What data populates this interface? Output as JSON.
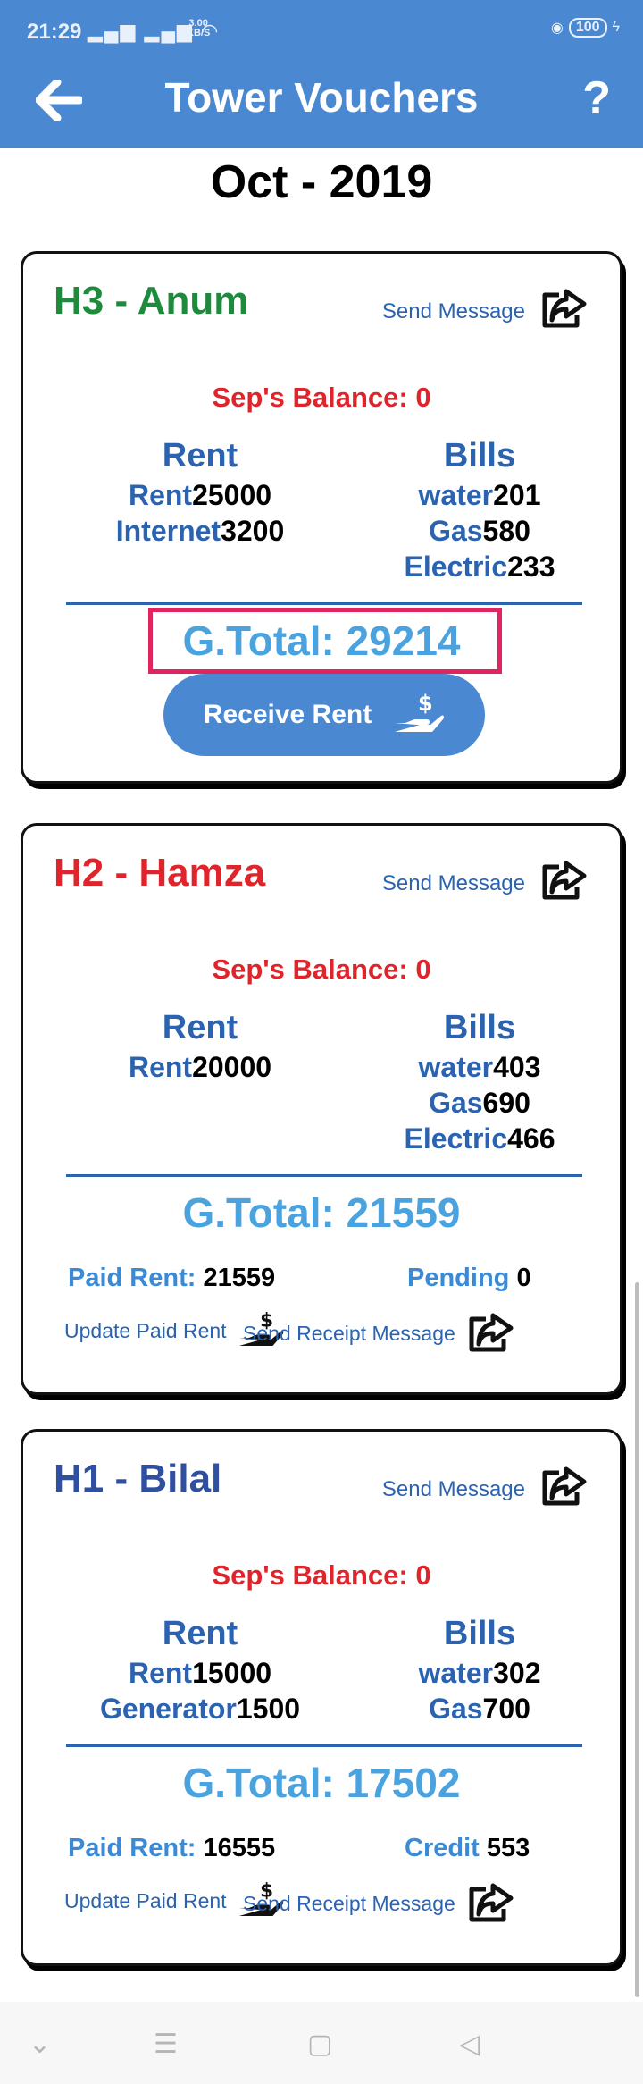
{
  "status_bar": {
    "time": "21:29",
    "speed_value": "3.00",
    "speed_unit": "KB/S",
    "battery": "100"
  },
  "app_bar": {
    "title": "Tower Vouchers",
    "help_label": "?"
  },
  "month": "Oct - 2019",
  "cards": [
    {
      "name": "H3 - Anum",
      "name_color": "#1e8a3c",
      "send_message": "Send Message",
      "balance": "Sep's Balance: 0",
      "rent_header": "Rent",
      "bills_header": "Bills",
      "rent_items": [
        {
          "label": "Rent",
          "value": "25000"
        },
        {
          "label": "Internet",
          "value": "3200"
        }
      ],
      "bill_items": [
        {
          "label": "water",
          "value": "201"
        },
        {
          "label": "Gas",
          "value": "580"
        },
        {
          "label": "Electric",
          "value": "233"
        }
      ],
      "grand_total": "G.Total: 29214",
      "receive_button": "Receive Rent"
    },
    {
      "name": "H2 - Hamza",
      "name_color": "#e0242b",
      "send_message": "Send Message",
      "balance": "Sep's Balance: 0",
      "rent_header": "Rent",
      "bills_header": "Bills",
      "rent_items": [
        {
          "label": "Rent",
          "value": "20000"
        }
      ],
      "bill_items": [
        {
          "label": "water",
          "value": "403"
        },
        {
          "label": "Gas",
          "value": "690"
        },
        {
          "label": "Electric",
          "value": "466"
        }
      ],
      "grand_total": "G.Total: 21559",
      "paid_label": "Paid Rent:",
      "paid_value": "21559",
      "status_label": "Pending",
      "status_value": "0",
      "update_paid": "Update Paid Rent",
      "send_receipt": "Send Receipt Message"
    },
    {
      "name": "H1 - Bilal",
      "name_color": "#2f4fa0",
      "send_message": "Send Message",
      "balance": "Sep's Balance: 0",
      "rent_header": "Rent",
      "bills_header": "Bills",
      "rent_items": [
        {
          "label": "Rent",
          "value": "15000"
        },
        {
          "label": "Generator",
          "value": "1500"
        }
      ],
      "bill_items": [
        {
          "label": "water",
          "value": "302"
        },
        {
          "label": "Gas",
          "value": "700"
        }
      ],
      "grand_total": "G.Total: 17502",
      "paid_label": "Paid Rent:",
      "paid_value": "16555",
      "status_label": "Credit",
      "status_value": "553",
      "update_paid": "Update Paid Rent",
      "send_receipt": "Send Receipt Message"
    }
  ],
  "colors": {
    "app_bar": "#4a89d2",
    "label_blue": "#2b63b0",
    "total_blue": "#4aa3df",
    "balance_red": "#e0242b",
    "highlight": "#e0245e"
  }
}
